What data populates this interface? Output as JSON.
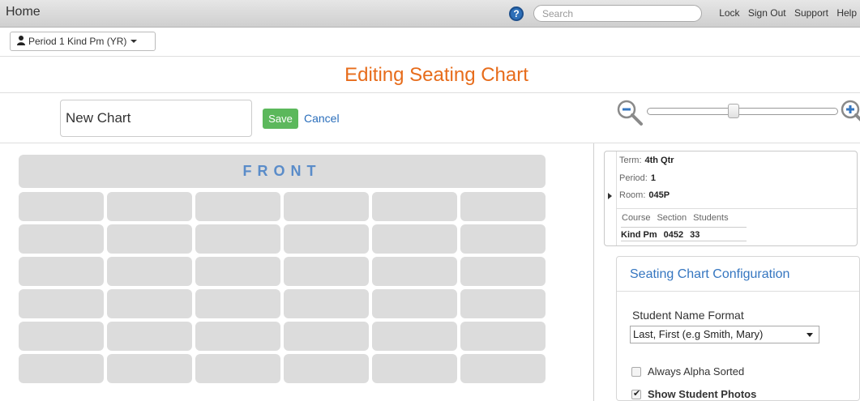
{
  "topbar": {
    "home_label": "Home",
    "help_icon_glyph": "?",
    "search_placeholder": "Search",
    "links": [
      "Lock",
      "Sign Out",
      "Support",
      "Help"
    ]
  },
  "period_selector": {
    "label": "Period 1 Kind Pm (YR)"
  },
  "page_title": "Editing Seating Chart",
  "chart_name": {
    "value": "New Chart"
  },
  "actions": {
    "save_label": "Save",
    "cancel_label": "Cancel"
  },
  "zoom": {
    "level": 0.45
  },
  "seating": {
    "front_label": "FRONT",
    "rows": 6,
    "columns": 6
  },
  "info": {
    "term_label": "Term:",
    "term_value": "4th Qtr",
    "period_label": "Period:",
    "period_value": "1",
    "room_label": "Room:",
    "room_value": "045P",
    "course_header": "Course",
    "section_header": "Section",
    "students_header": "Students",
    "course_value": "Kind Pm",
    "section_value": "0452",
    "students_value": "33"
  },
  "config": {
    "title": "Seating Chart Configuration",
    "name_format_label": "Student Name Format",
    "name_format_selected": "Last, First (e.g Smith, Mary)",
    "always_alpha_label": "Always Alpha Sorted",
    "always_alpha_checked": false,
    "show_photos_label": "Show Student Photos",
    "show_photos_checked": true
  },
  "colors": {
    "title_orange": "#e76c1b",
    "link_blue": "#2a6ebb",
    "save_green": "#5cb85c",
    "front_blue": "#5a8cc9",
    "desk_gray": "#dcdcdc"
  }
}
